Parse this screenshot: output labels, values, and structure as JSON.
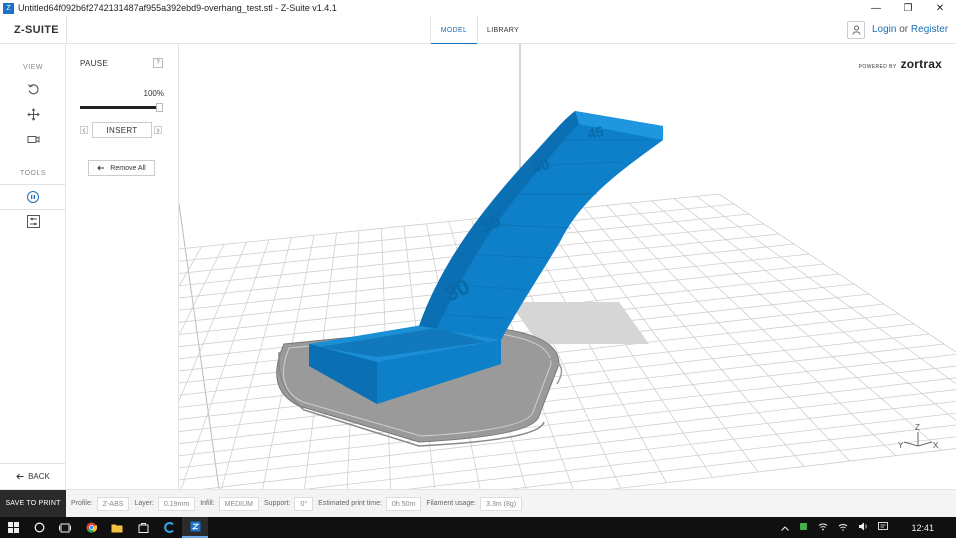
{
  "window": {
    "title": "Untitled64f092b6f2742131487af955a392ebd9-overhang_test.stl - Z-Suite v1.4.1",
    "app_icon_letter": "Z",
    "minimize": "—",
    "restore": "❐",
    "close": "✕"
  },
  "header": {
    "logo": "Z-SUITE",
    "tabs": [
      {
        "label": "MODEL",
        "active": true
      },
      {
        "label": "LIBRARY",
        "active": false
      }
    ],
    "login": "Login",
    "or": " or ",
    "register": "Register"
  },
  "toolbar": {
    "view_label": "VIEW",
    "tools_label": "TOOLS",
    "back_label": "BACK"
  },
  "panel": {
    "title": "PAUSE",
    "help": "?",
    "percent_label": "100%",
    "progress": 1.0,
    "insert_label": "INSERT",
    "remove_all_label": "Remove All"
  },
  "viewport": {
    "powered_by": "POWERED BY",
    "brand": "zortrax",
    "model_labels": [
      "30",
      "35",
      "40",
      "45"
    ],
    "model_color": "#0e7fc9",
    "axes": {
      "x": "X",
      "y": "Y",
      "z": "Z"
    }
  },
  "status": {
    "save_label": "SAVE TO PRINT",
    "profile_label": "Profile:",
    "profile_value": "Z-ABS",
    "layer_label": "Layer:",
    "layer_value": "0.19mm",
    "infill_label": "Infill:",
    "infill_value": "MEDIUM",
    "support_label": "Support:",
    "support_value": "0°",
    "time_label": "Estimated print time:",
    "time_value": "0h 50m",
    "filament_label": "Filament usage:",
    "filament_value": "3.3m (8g)"
  },
  "taskbar": {
    "clock": "12:41"
  },
  "colors": {
    "accent": "#1e6fb8",
    "model": "#0e7fc9"
  }
}
